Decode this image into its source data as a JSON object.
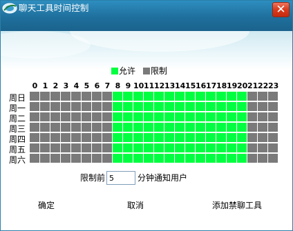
{
  "window": {
    "title": "聊天工具时间控制",
    "close_symbol": "✕"
  },
  "colors": {
    "allowed": "#00ff40",
    "restricted": "#7a7a7a"
  },
  "legend": {
    "allowed_label": "允许",
    "restricted_label": "限制"
  },
  "schedule": {
    "hours": [
      "0",
      "1",
      "2",
      "3",
      "4",
      "5",
      "6",
      "7",
      "8",
      "9",
      "10",
      "11",
      "12",
      "13",
      "14",
      "15",
      "16",
      "17",
      "18",
      "19",
      "20",
      "21",
      "22",
      "23"
    ],
    "days": [
      "周日",
      "周一",
      "周二",
      "周三",
      "周四",
      "周五",
      "周六"
    ],
    "allowed_hours": [
      8,
      9,
      10,
      11,
      12,
      13,
      14,
      15,
      16,
      17,
      18,
      19,
      20
    ]
  },
  "warning": {
    "prefix": "限制前",
    "minutes_value": "5",
    "suffix": "分钟通知用户"
  },
  "buttons": {
    "ok": "确定",
    "cancel": "取消",
    "add_blocked": "添加禁聊工具"
  }
}
